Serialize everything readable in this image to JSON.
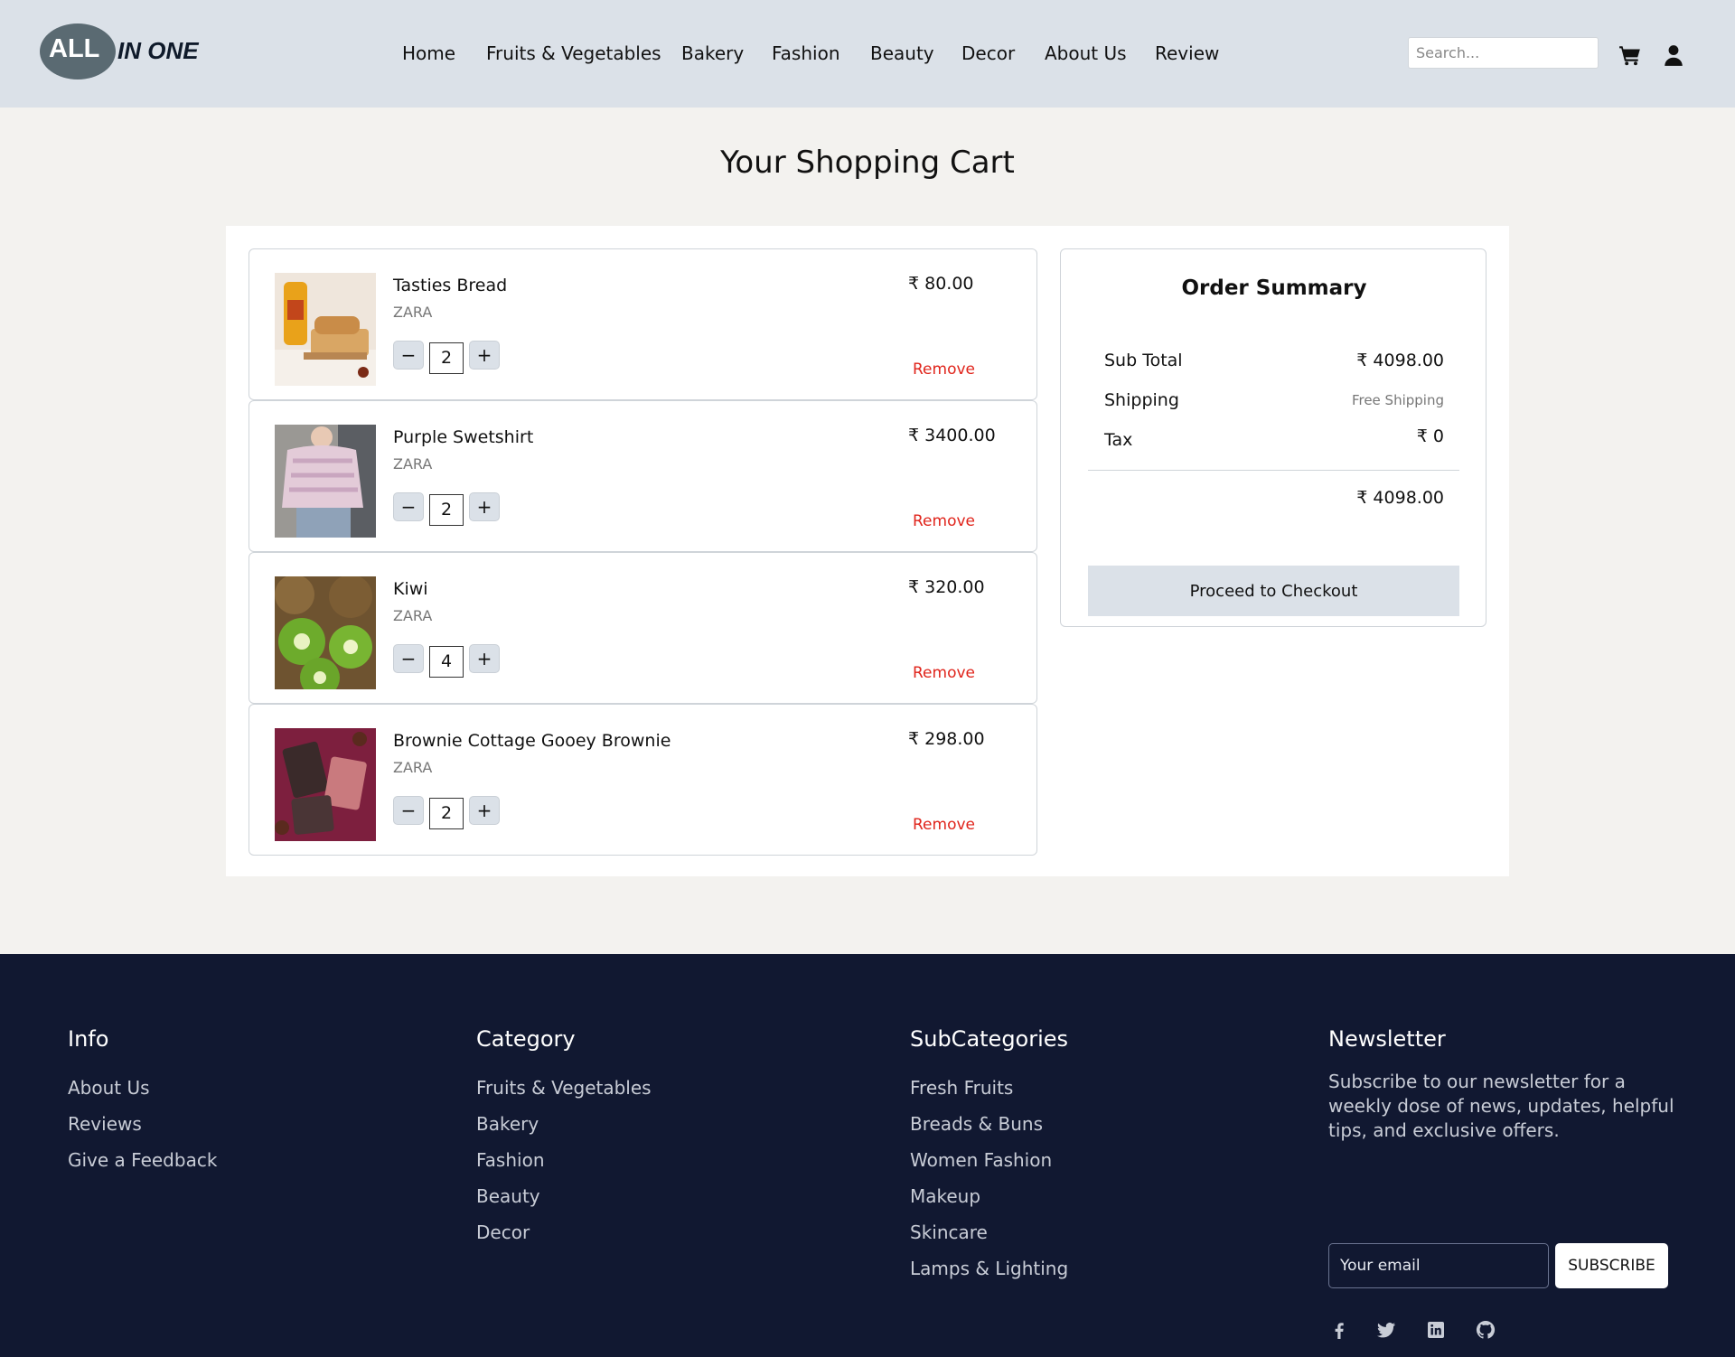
{
  "brand": {
    "logo_main": "ALL",
    "logo_sub": "IN ONE"
  },
  "nav": [
    "Home",
    "Fruits & Vegetables",
    "Bakery",
    "Fashion",
    "Beauty",
    "Decor",
    "About Us",
    "Review"
  ],
  "search": {
    "placeholder": "Search..."
  },
  "icons": {
    "cart": "cart-icon",
    "user": "user-icon"
  },
  "page_title": "Your Shopping Cart",
  "cart": {
    "items": [
      {
        "name": "Tasties Bread",
        "brand": "ZARA",
        "qty": "2",
        "price": "₹ 80.00",
        "remove": "Remove",
        "image": "bread-image"
      },
      {
        "name": "Purple Swetshirt",
        "brand": "ZARA",
        "qty": "2",
        "price": "₹ 3400.00",
        "remove": "Remove",
        "image": "sweatshirt-image"
      },
      {
        "name": "Kiwi",
        "brand": "ZARA",
        "qty": "4",
        "price": "₹ 320.00",
        "remove": "Remove",
        "image": "kiwi-image"
      },
      {
        "name": "Brownie Cottage Gooey Brownie",
        "brand": "ZARA",
        "qty": "2",
        "price": "₹ 298.00",
        "remove": "Remove",
        "image": "brownie-image"
      }
    ],
    "minus": "−",
    "plus": "+"
  },
  "summary": {
    "title": "Order Summary",
    "subtotal_label": "Sub Total",
    "subtotal": "₹ 4098.00",
    "shipping_label": "Shipping",
    "shipping": "Free Shipping",
    "tax_label": "Tax",
    "tax": "₹ 0",
    "total": "₹ 4098.00",
    "checkout": "Proceed to Checkout"
  },
  "footer": {
    "info": {
      "title": "Info",
      "links": [
        "About Us",
        "Reviews",
        "Give a Feedback"
      ]
    },
    "category": {
      "title": "Category",
      "links": [
        "Fruits & Vegetables",
        "Bakery",
        "Fashion",
        "Beauty",
        "Decor"
      ]
    },
    "subcategories": {
      "title": "SubCategories",
      "links": [
        "Fresh Fruits",
        "Breads & Buns",
        "Women Fashion",
        "Makeup",
        "Skincare",
        "Lamps & Lighting"
      ]
    },
    "newsletter": {
      "title": "Newsletter",
      "text": "Subscribe to our newsletter for a weekly dose of news, updates, helpful tips, and exclusive offers.",
      "placeholder": "Your email",
      "button": "SUBSCRIBE"
    },
    "social": [
      "facebook-icon",
      "twitter-icon",
      "linkedin-icon",
      "github-icon"
    ]
  },
  "colors": {
    "header_bg": "#dbe1e8",
    "footer_bg": "#111831",
    "remove": "#e0241b",
    "page_bg": "#f3f2ef"
  }
}
